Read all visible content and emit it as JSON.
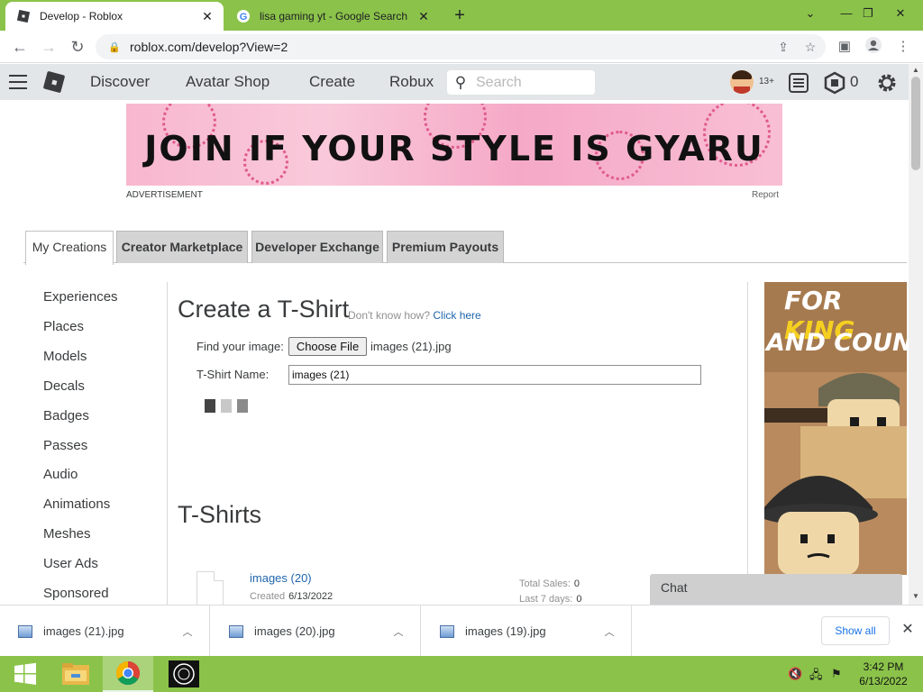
{
  "browser": {
    "tabs": [
      {
        "title": "Develop - Roblox",
        "active": true
      },
      {
        "title": "lisa gaming yt - Google Search",
        "active": false
      }
    ],
    "url": "roblox.com/develop?View=2"
  },
  "header": {
    "nav": [
      "Discover",
      "Avatar Shop",
      "Create",
      "Robux"
    ],
    "search_placeholder": "Search",
    "age_badge": "13+",
    "robux_count": "0"
  },
  "ad": {
    "banner_text": "JOIN IF YOUR STYLE IS GYARU",
    "label": "ADVERTISEMENT",
    "report": "Report",
    "side_ad_line1": "FOR ",
    "side_ad_line1_accent": "KING",
    "side_ad_line2": "AND COUNTRY"
  },
  "page_tabs": [
    "My Creations",
    "Creator Marketplace",
    "Developer Exchange",
    "Premium Payouts"
  ],
  "left_nav": [
    "Experiences",
    "Places",
    "Models",
    "Decals",
    "Badges",
    "Passes",
    "Audio",
    "Animations",
    "Meshes",
    "User Ads",
    "Sponsored"
  ],
  "create_form": {
    "title": "Create a T-Shirt",
    "hint_prefix": "Don't know how?",
    "hint_link": "Click here",
    "find_image_label": "Find your image:",
    "choose_file_label": "Choose File",
    "chosen_file": "images (21).jpg",
    "name_label": "T-Shirt Name:",
    "name_value": "images (21)"
  },
  "tshirts": {
    "title": "T-Shirts",
    "items": [
      {
        "name": "images (20)",
        "created_label": "Created",
        "created_date": "6/13/2022",
        "total_sales_label": "Total Sales:",
        "total_sales": "0",
        "last7_label": "Last 7 days:",
        "last7": "0"
      }
    ]
  },
  "chat": {
    "label": "Chat"
  },
  "downloads": {
    "items": [
      "images (21).jpg",
      "images (20).jpg",
      "images (19).jpg"
    ],
    "show_all": "Show all"
  },
  "taskbar": {
    "time": "3:42 PM",
    "date": "6/13/2022"
  },
  "colors": {
    "accent_green": "#8bc34a",
    "link_blue": "#1e66ad",
    "roblox_header": "#e3e6e8"
  }
}
